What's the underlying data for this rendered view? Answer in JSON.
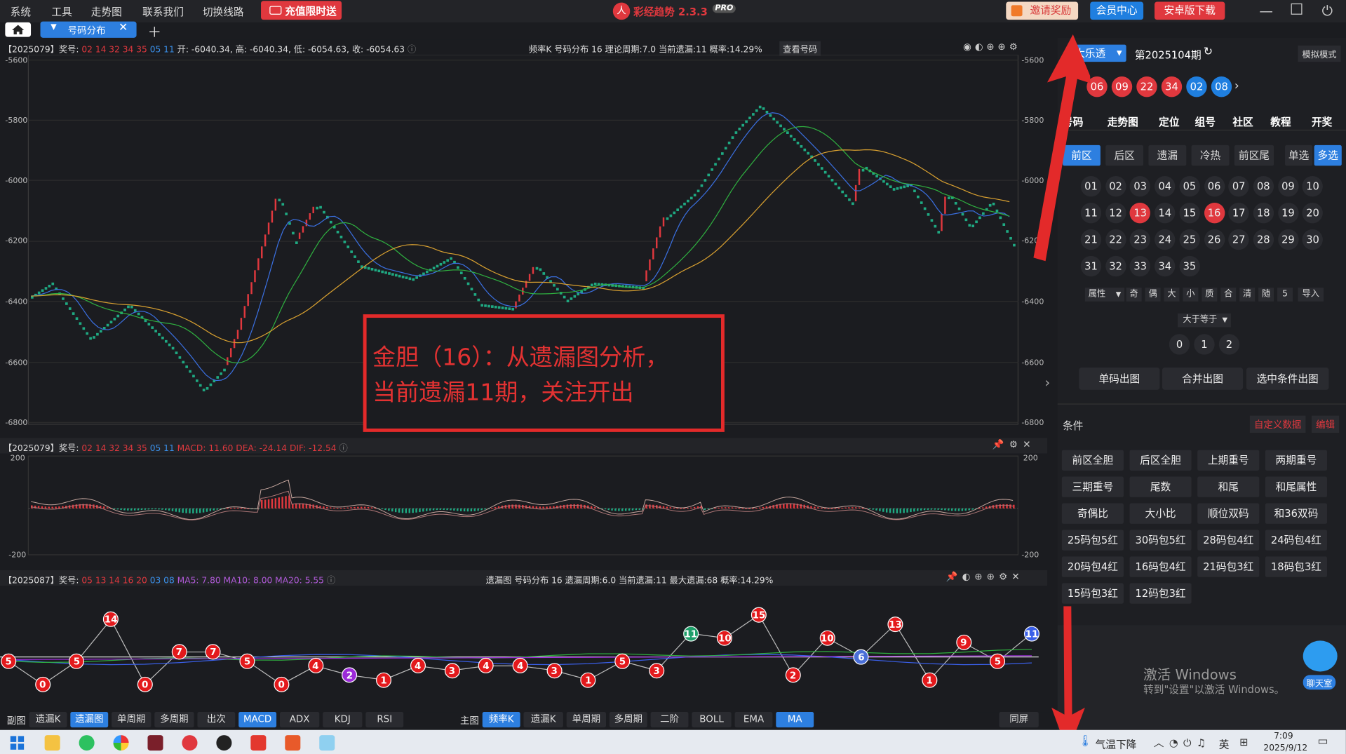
{
  "menu": [
    "系统",
    "工具",
    "走势图",
    "联系我们",
    "切换线路"
  ],
  "promo": "充值限时送",
  "app_name": "彩经趋势 2.3.3",
  "pro": "PRO",
  "buttons": {
    "invite": "邀请奖励",
    "member": "会员中心",
    "android": "安卓版下载"
  },
  "tab": {
    "label": "号码分布"
  },
  "kline": {
    "header_id": "【2025079】奖号:",
    "header_nums": "02 14 32 34 35",
    "header_blue": "05 11",
    "header_ohlc": "开: -6040.34, 高: -6040.34, 低: -6054.63, 收: -6054.63",
    "header_right": "频率K  号码分布  16    理论周期:7.0  当前遗漏:11  概率:14.29%",
    "lookup": "查看号码",
    "yticks": [
      "-5600",
      "-5800",
      "-6000",
      "-6200",
      "-6400",
      "-6600",
      "-6800"
    ]
  },
  "macd": {
    "header_id": "【2025079】奖号:",
    "header_nums": "02 14 32 34 35",
    "header_blue": "05 11",
    "header_vals": "MACD: 11.60  DEA: -24.14  DIF: -12.54",
    "ytop": "200",
    "ybot": "-200"
  },
  "omit": {
    "header_id": "【2025087】奖号:",
    "header_nums": "05 13 14 16 20",
    "header_blue": "03 08",
    "header_ma": "MA5: 7.80  MA10: 8.00  MA20: 5.55",
    "header_right": "遗漏图  号码分布  16     遗漏周期:6.0  当前遗漏:11  最大遗漏:68  概率:14.29%",
    "markers": [
      {
        "v": "5",
        "c": "#e3191c"
      },
      {
        "v": "0",
        "c": "#e3191c"
      },
      {
        "v": "5",
        "c": "#e3191c"
      },
      {
        "v": "14",
        "c": "#e3191c"
      },
      {
        "v": "0",
        "c": "#e3191c"
      },
      {
        "v": "7",
        "c": "#e3191c"
      },
      {
        "v": "7",
        "c": "#e3191c"
      },
      {
        "v": "5",
        "c": "#e3191c"
      },
      {
        "v": "0",
        "c": "#e3191c"
      },
      {
        "v": "4",
        "c": "#e3191c"
      },
      {
        "v": "2",
        "c": "#9b2ad8"
      },
      {
        "v": "1",
        "c": "#e3191c"
      },
      {
        "v": "4",
        "c": "#e3191c"
      },
      {
        "v": "3",
        "c": "#e3191c"
      },
      {
        "v": "4",
        "c": "#e3191c"
      },
      {
        "v": "4",
        "c": "#e3191c"
      },
      {
        "v": "3",
        "c": "#e3191c"
      },
      {
        "v": "1",
        "c": "#e3191c"
      },
      {
        "v": "5",
        "c": "#e3191c"
      },
      {
        "v": "3",
        "c": "#e3191c"
      },
      {
        "v": "11",
        "c": "#1f9f6a"
      },
      {
        "v": "10",
        "c": "#e3191c"
      },
      {
        "v": "15",
        "c": "#e3191c"
      },
      {
        "v": "2",
        "c": "#e3191c"
      },
      {
        "v": "10",
        "c": "#e3191c"
      },
      {
        "v": "6",
        "c": "#4a6fd8"
      },
      {
        "v": "13",
        "c": "#e3191c"
      },
      {
        "v": "1",
        "c": "#e3191c"
      },
      {
        "v": "9",
        "c": "#e3191c"
      },
      {
        "v": "5",
        "c": "#e3191c"
      },
      {
        "v": "11",
        "c": "#3a5fe8"
      }
    ]
  },
  "annotation": {
    "line1": "金胆（16）：从遗漏图分析，",
    "line2": "当前遗漏11期，关注开出"
  },
  "bottom_left": [
    "副图",
    "遗漏K",
    "遗漏图",
    "单周期",
    "多周期",
    "出次",
    "MACD",
    "ADX",
    "KDJ",
    "RSI"
  ],
  "bottom_right": [
    "主图",
    "频率K",
    "遗漏K",
    "单周期",
    "多周期",
    "二阶",
    "BOLL",
    "EMA",
    "MA"
  ],
  "same_screen": "同屏",
  "right": {
    "lottery": "大乐透",
    "period": "第2025104期",
    "mode": "模拟模式",
    "balls": [
      {
        "v": "06",
        "c": "#e0383e"
      },
      {
        "v": "09",
        "c": "#e0383e"
      },
      {
        "v": "22",
        "c": "#e0383e"
      },
      {
        "v": "34",
        "c": "#e0383e"
      },
      {
        "v": "02",
        "c": "#1f7fe0"
      },
      {
        "v": "08",
        "c": "#1f7fe0"
      }
    ],
    "tabs": [
      "号码",
      "走势图",
      "定位",
      "组号",
      "社区",
      "教程",
      "开奖"
    ],
    "filters": [
      "前区",
      "后区",
      "遗漏",
      "冷热",
      "前区尾"
    ],
    "single": "单选",
    "multi": "多选",
    "numbers": [
      "01",
      "02",
      "03",
      "04",
      "05",
      "06",
      "07",
      "08",
      "09",
      "10",
      "11",
      "12",
      "13",
      "14",
      "15",
      "16",
      "17",
      "18",
      "19",
      "20",
      "21",
      "22",
      "23",
      "24",
      "25",
      "26",
      "27",
      "28",
      "29",
      "30",
      "31",
      "32",
      "33",
      "34",
      "35"
    ],
    "selected": [
      "13",
      "16"
    ],
    "attr": "属性",
    "attr_btns": [
      "奇",
      "偶",
      "大",
      "小",
      "质",
      "合",
      "清",
      "随",
      "5",
      "导入"
    ],
    "gte": "大于等于",
    "counts": [
      "0",
      "1",
      "2"
    ],
    "actions": [
      "单码出图",
      "合并出图",
      "选中条件出图"
    ],
    "conditions_title": "条件",
    "custom": "自定义数据",
    "edit": "编辑",
    "conditions": [
      "前区全胆",
      "后区全胆",
      "上期重号",
      "两期重号",
      "三期重号",
      "尾数",
      "和尾",
      "和尾属性",
      "奇偶比",
      "大小比",
      "顺位双码",
      "和36双码",
      "25码包5红",
      "30码包5红",
      "28码包4红",
      "24码包4红",
      "20码包4红",
      "16码包4红",
      "21码包3红",
      "18码包3红",
      "15码包3红",
      "12码包3红"
    ],
    "activate1": "激活 Windows",
    "activate2": "转到\"设置\"以激活 Windows。",
    "chat": "聊天室"
  },
  "taskbar": {
    "weather": "气温下降",
    "ime": "英",
    "time": "7:09",
    "date": "2025/9/12"
  }
}
